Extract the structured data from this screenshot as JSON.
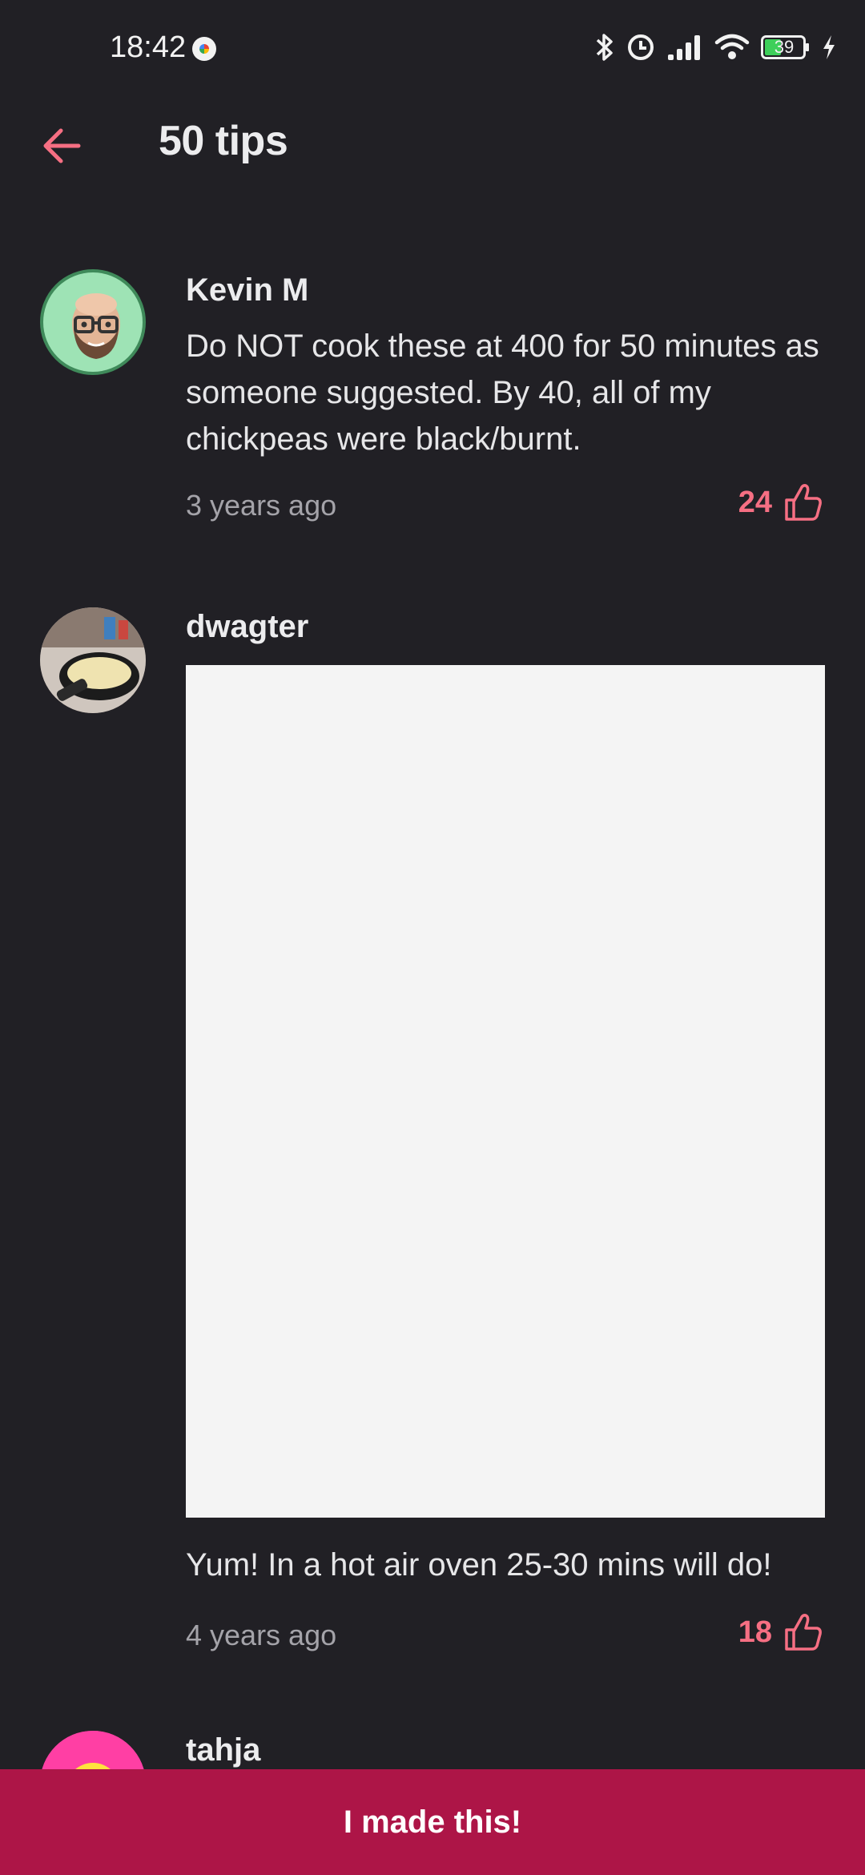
{
  "status_bar": {
    "time": "18:42",
    "battery_level": "39",
    "icons": [
      "bluetooth-icon",
      "alarm-icon",
      "signal-icon",
      "wifi-icon",
      "battery-icon",
      "charging-icon"
    ]
  },
  "header": {
    "title": "50 tips",
    "back_icon": "arrow-left-icon"
  },
  "tips": [
    {
      "author": "Kevin M",
      "text": "Do NOT cook these at 400 for 50 minutes as someone suggested. By 40, all of my chickpeas were black/burnt.",
      "time_ago": "3 years ago",
      "likes": "24"
    },
    {
      "author": "dwagter",
      "text": "Yum! In a hot air oven 25-30 mins will do!",
      "time_ago": "4 years ago",
      "likes": "18"
    },
    {
      "author": "tahja"
    }
  ],
  "cta": {
    "label": "I made this!"
  },
  "colors": {
    "background": "#212025",
    "accent": "#f66f83",
    "cta_background": "#ad1547"
  }
}
